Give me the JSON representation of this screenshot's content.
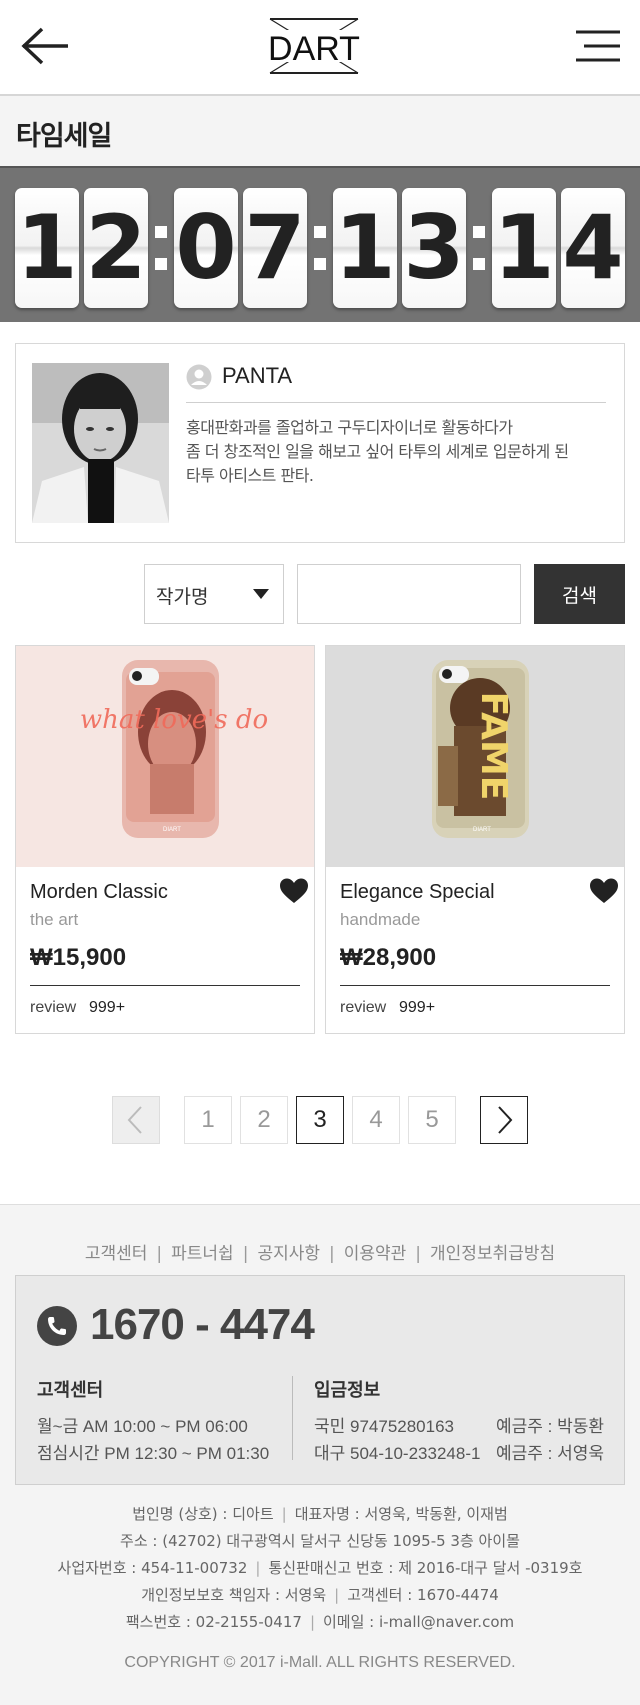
{
  "header": {
    "logo_text": "DART",
    "back_icon": "arrow-left-icon",
    "menu_icon": "hamburger-icon"
  },
  "page_title": "타임세일",
  "countdown": {
    "digits": [
      "1",
      "2",
      "0",
      "7",
      "1",
      "3",
      "1",
      "4"
    ]
  },
  "artist": {
    "name": "PANTA",
    "bio": "홍대판화과를 졸업하고 구두디자이너로 활동하다가\n좀 더 창조적인 일을 해보고 싶어 타투의 세계로 입문하게 된\n타투 아티스트 판타."
  },
  "search": {
    "select_label": "작가명",
    "input_value": "",
    "button_label": "검색"
  },
  "products": [
    {
      "name": "Morden Classic",
      "sub": "the art",
      "price": "₩15,900",
      "review_label": "review",
      "review_count": "999+",
      "case_text": "what love's do",
      "brand": "DIART"
    },
    {
      "name": "Elegance Special",
      "sub": "handmade",
      "price": "₩28,900",
      "review_label": "review",
      "review_count": "999+",
      "case_text": "FAME",
      "brand": "DIART"
    }
  ],
  "pagination": {
    "pages": [
      "1",
      "2",
      "3",
      "4",
      "5"
    ],
    "current": "3"
  },
  "footer": {
    "links": [
      "고객센터",
      "파트너쉽",
      "공지사항",
      "이용약관",
      "개인정보취급방침"
    ],
    "phone": "1670 - 4474",
    "cs": {
      "title": "고객센터",
      "hours": "월~금   AM 10:00 ~ PM 06:00",
      "lunch": "점심시간   PM 12:30 ~ PM 01:30"
    },
    "deposit": {
      "title": "입금정보",
      "bank1": "국민  97475280163",
      "holder1": "예금주 : 박동환",
      "bank2": "대구  504-10-233248-1",
      "holder2": "예금주 : 서영욱"
    },
    "company": {
      "corp_name": "법인명 (상호) : 디아트",
      "ceo": "대표자명 : 서영욱, 박동환, 이재범",
      "address": "주소 : (42702) 대구광역시 달서구 신당동 1095-5  3층 아이몰",
      "biz_no": "사업자번호 : 454-11-00732",
      "mail_order": "통신판매신고 번호 : 제 2016-대구 달서 -0319호",
      "privacy_officer": "개인정보보호 책임자  :  서영욱",
      "cs_center": "고객센터 : 1670-4474",
      "fax": "팩스번호 :  02-2155-0417",
      "email": "이메일 : i-mall@naver.com"
    },
    "copyright": "COPYRIGHT © 2017 i-Mall. ALL RIGHTS RESERVED."
  }
}
